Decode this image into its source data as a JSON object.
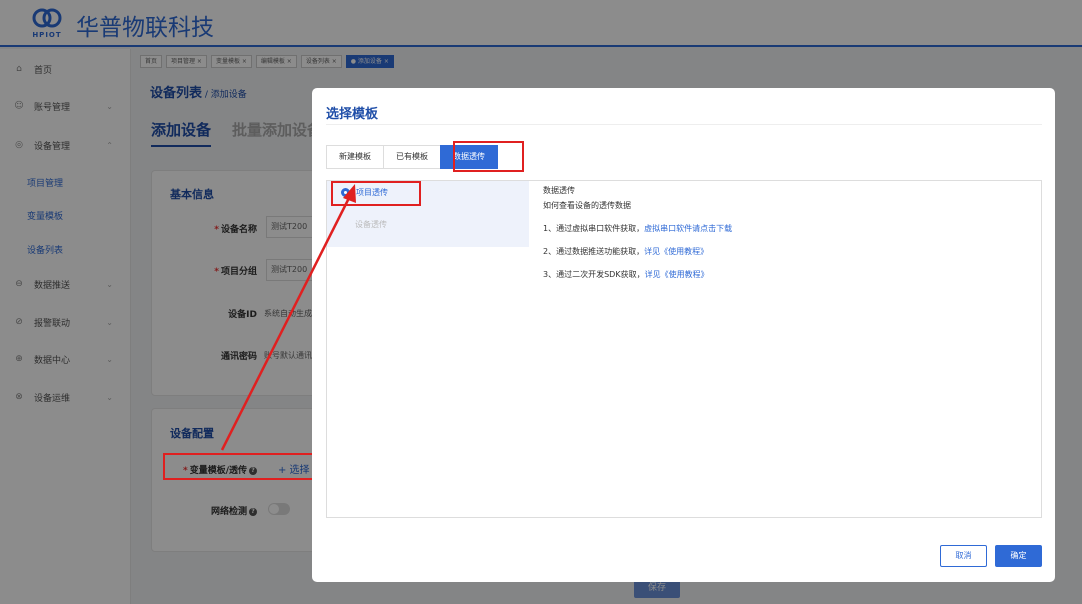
{
  "header": {
    "logo_mark": "⌘",
    "logo_text": "HPIOT",
    "brand": "华普物联科技"
  },
  "sidebar": {
    "items": [
      {
        "label": "首页",
        "icon": "home-icon",
        "glyph": "⌂"
      },
      {
        "label": "账号管理",
        "icon": "user-icon",
        "glyph": "☺"
      },
      {
        "label": "设备管理",
        "icon": "device-icon",
        "glyph": "◎"
      },
      {
        "label": "数据推送",
        "icon": "push-icon",
        "glyph": "⊖"
      },
      {
        "label": "报警联动",
        "icon": "alarm-icon",
        "glyph": "⊘"
      },
      {
        "label": "数据中心",
        "icon": "data-icon",
        "glyph": "⊕"
      },
      {
        "label": "设备运维",
        "icon": "maintenance-icon",
        "glyph": "⊗"
      }
    ],
    "sub_items": [
      "项目管理",
      "变量模板",
      "设备列表"
    ]
  },
  "tabs": [
    {
      "label": "首页"
    },
    {
      "label": "项目管理 ×"
    },
    {
      "label": "变量模板 ×"
    },
    {
      "label": "编辑模板 ×"
    },
    {
      "label": "设备列表 ×"
    },
    {
      "label": "● 添加设备 ×"
    }
  ],
  "page": {
    "breadcrumb": "设备列表",
    "breadcrumb_sub": " / 添加设备",
    "tab_add": "添加设备",
    "tab_batch": "批量添加设备",
    "basic_title": "基本信息",
    "device_name_label": "设备名称",
    "device_name_value": "测试T200",
    "project_group_label": "项目分组",
    "project_group_value": "测试T200",
    "device_id_label": "设备ID",
    "device_id_value": "系统自动生成",
    "comm_pwd_label": "通讯密码",
    "comm_pwd_value": "账号默认通讯密码",
    "config_title": "设备配置",
    "template_label": "变量模板/透传",
    "template_select": "+ 选择",
    "network_label": "网络检测",
    "save": "保存"
  },
  "modal": {
    "title": "选择模板",
    "tabs": [
      "新建模板",
      "已有模板",
      "数据透传"
    ],
    "options": [
      "项目透传",
      "设备透传"
    ],
    "content": {
      "heading": "数据透传",
      "howto": "如何查看设备的透传数据",
      "step1": "1、通过虚拟串口软件获取，",
      "step1_link": "虚拟串口软件请点击下载",
      "step2": "2、通过数据推送功能获取，",
      "step2_link": "详见《使用教程》",
      "step3": "3、通过二次开发SDK获取，",
      "step3_link": "详见《使用教程》"
    },
    "cancel": "取消",
    "confirm": "确定"
  },
  "colors": {
    "accent": "#2f6ad6",
    "highlight": "#e02020"
  }
}
